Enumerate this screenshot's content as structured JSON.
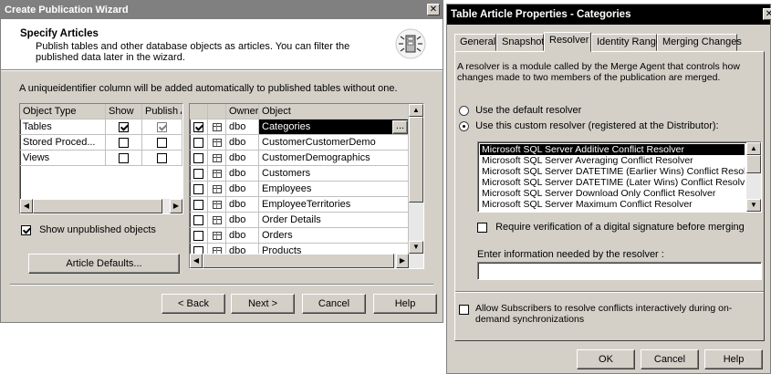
{
  "wizard": {
    "title": "Create Publication Wizard",
    "close_glyph": "✕",
    "header_title": "Specify Articles",
    "header_desc": "Publish tables and other database objects as articles. You can filter the published data later in the wizard.",
    "note": "A uniqueidentifier column will be added automatically to published tables without one.",
    "object_type_table": {
      "headers": [
        "Object Type",
        "Show",
        "Publish A"
      ],
      "rows": [
        {
          "type": "Tables",
          "show": true,
          "publish": true
        },
        {
          "type": "Stored Proced...",
          "show": false,
          "publish": false
        },
        {
          "type": "Views",
          "show": false,
          "publish": false
        }
      ]
    },
    "show_unpublished_label": "Show unpublished objects",
    "show_unpublished_checked": true,
    "article_defaults_label": "Article Defaults...",
    "object_list": {
      "headers": [
        "",
        "",
        "Owner",
        "Object"
      ],
      "rows": [
        {
          "checked": true,
          "owner": "dbo",
          "object": "Categories",
          "selected": true
        },
        {
          "checked": false,
          "owner": "dbo",
          "object": "CustomerCustomerDemo",
          "selected": false
        },
        {
          "checked": false,
          "owner": "dbo",
          "object": "CustomerDemographics",
          "selected": false
        },
        {
          "checked": false,
          "owner": "dbo",
          "object": "Customers",
          "selected": false
        },
        {
          "checked": false,
          "owner": "dbo",
          "object": "Employees",
          "selected": false
        },
        {
          "checked": false,
          "owner": "dbo",
          "object": "EmployeeTerritories",
          "selected": false
        },
        {
          "checked": false,
          "owner": "dbo",
          "object": "Order Details",
          "selected": false
        },
        {
          "checked": false,
          "owner": "dbo",
          "object": "Orders",
          "selected": false
        },
        {
          "checked": false,
          "owner": "dbo",
          "object": "Products",
          "selected": false
        }
      ],
      "ellipsis_label": "..."
    },
    "buttons": {
      "back": "< Back",
      "next": "Next >",
      "cancel": "Cancel",
      "help": "Help"
    }
  },
  "props": {
    "title": "Table Article Properties - Categories",
    "close_glyph": "✕",
    "tabs": [
      "General",
      "Snapshot",
      "Resolver",
      "Identity Range",
      "Merging Changes"
    ],
    "active_tab": "Resolver",
    "description": "A resolver is a module called by the Merge Agent that controls how changes made to two members of the publication are merged.",
    "radio_default": "Use the default resolver",
    "radio_custom": "Use this custom resolver (registered at the Distributor):",
    "selected_radio": "custom",
    "resolvers": [
      "Microsoft SQL Server Additive Conflict Resolver",
      "Microsoft SQL Server Averaging Conflict Resolver",
      "Microsoft SQL Server DATETIME (Earlier Wins) Conflict Resolver",
      "Microsoft SQL Server DATETIME (Later Wins) Conflict Resolver",
      "Microsoft SQL Server Download Only Conflict Resolver",
      "Microsoft SQL Server Maximum Conflict Resolver"
    ],
    "selected_resolver_index": 0,
    "require_signature_label": "Require verification of a digital signature before merging",
    "require_signature_checked": false,
    "info_label": "Enter information needed by the resolver :",
    "info_value": "",
    "allow_interactive_label": "Allow Subscribers to resolve conflicts interactively during on-demand synchronizations",
    "allow_interactive_checked": false,
    "buttons": {
      "ok": "OK",
      "cancel": "Cancel",
      "help": "Help"
    }
  }
}
